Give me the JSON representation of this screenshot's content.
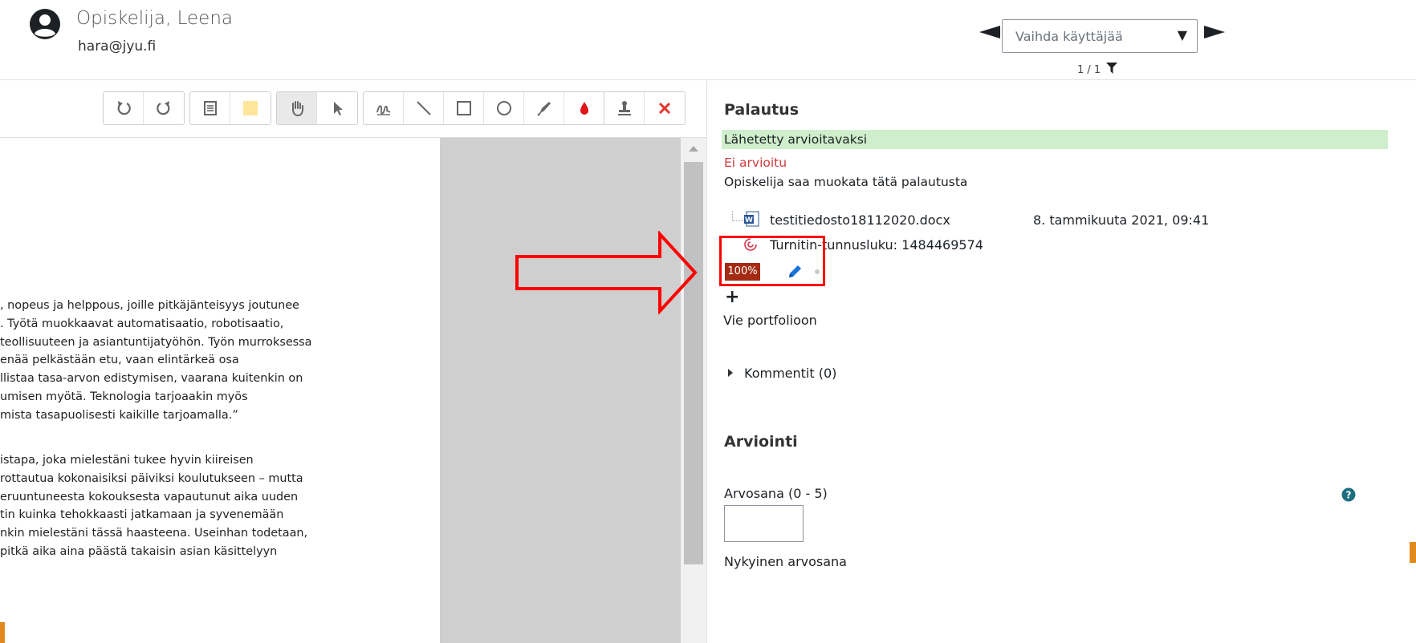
{
  "header": {
    "user_name": "Opiskelija, Leena",
    "user_email": "hara@jyu.fi",
    "user_select_placeholder": "Vaihda käyttäjää",
    "pager": "1 / 1"
  },
  "toolbar": {
    "buttons": [
      "undo-icon",
      "redo-icon",
      "comment-icon",
      "color-swatch",
      "hand-icon",
      "pointer-icon",
      "pen-icon",
      "line-icon",
      "rectangle-icon",
      "circle-icon",
      "highlighter-icon",
      "color-drop-icon",
      "stamp-icon",
      "delete-icon"
    ],
    "swatch_color": "#fde59a",
    "delete_color": "#e0362c",
    "drop_color": "#e0161b"
  },
  "document": {
    "paragraph1": [
      ", nopeus ja helppous, joille pitkäjänteisyys joutunee",
      ". Työtä muokkaavat automatisaatio, robotisaatio,",
      "teollisuuteen ja asiantuntijatyöhön. Työn murroksessa",
      "enää pelkästään etu, vaan elintärkeä osa",
      "llistaa tasa-arvon edistymisen, vaarana kuitenkin on",
      "umisen myötä. Teknologia tarjoaakin myös",
      "mista tasapuolisesti kaikille tarjoamalla.”"
    ],
    "paragraph2": [
      "istapa, joka mielestäni tukee hyvin kiireisen",
      "rottautua kokonaisiksi päiviksi koulutukseen – mutta",
      "eruuntuneesta kokouksesta vapautunut aika uuden",
      "tin kuinka tehokkaasti jatkamaan ja syvenemään",
      "nkin mielestäni tässä haasteena. Useinhan todetaan,",
      "pitkä aika aina päästä takaisin asian käsittelyyn"
    ]
  },
  "submission": {
    "title": "Palautus",
    "status_submitted": "Lähetetty arvioitavaksi",
    "status_grading": "Ei arvioitu",
    "status_edit": "Opiskelija saa muokata tätä palautusta",
    "file_name": "testitiedosto18112020.docx",
    "file_date": "8. tammikuuta 2021, 09:41",
    "turnitin_id": "Turnitin-tunnusluku: 1484469574",
    "similarity_score": "100%",
    "portfolio_link": "Vie portfolioon",
    "comments_label": "Kommentit (0)"
  },
  "grading": {
    "title": "Arviointi",
    "grade_label": "Arvosana (0 - 5)",
    "grade_value": "",
    "current_grade_label": "Nykyinen arvosana"
  },
  "colors": {
    "submitted_bg": "#cfeecb",
    "not_graded": "#d13c3c",
    "score_badge": "#a42a14",
    "annotation_red": "#ff0000"
  }
}
